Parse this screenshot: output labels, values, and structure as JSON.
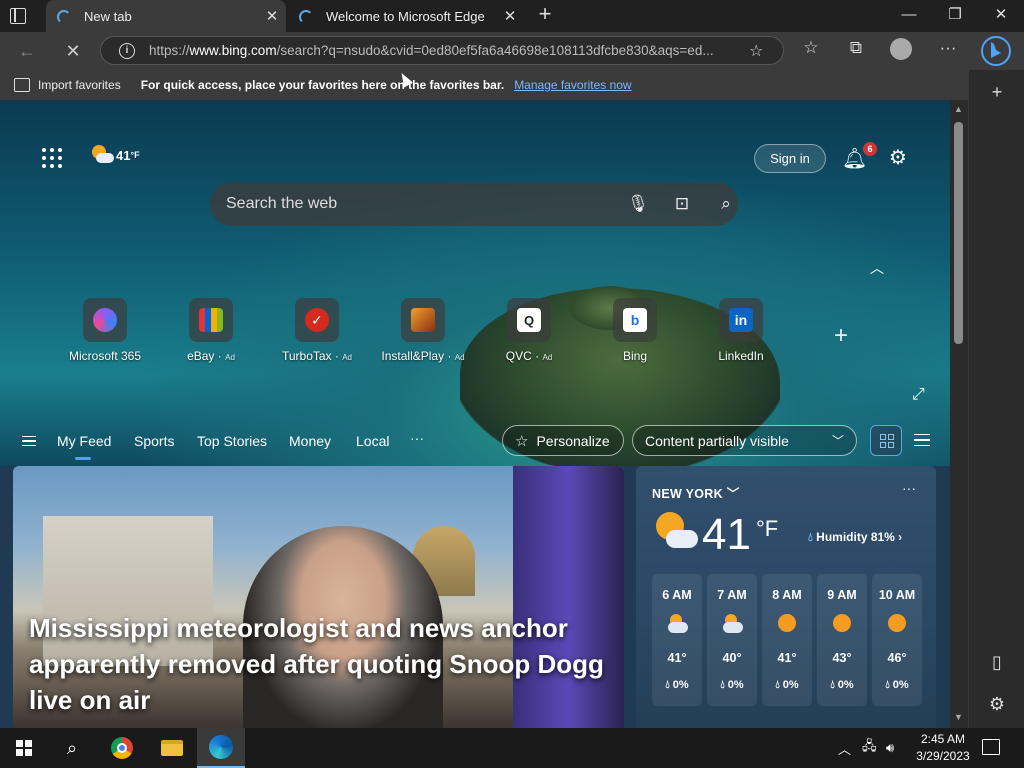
{
  "tabs": [
    {
      "title": "New tab",
      "active": true
    },
    {
      "title": "Welcome to Microsoft Edge",
      "active": false
    }
  ],
  "toolbar": {
    "url_prefix": "https://",
    "url_domain": "www.bing.com",
    "url_rest": "/search?q=nsudo&cvid=0ed80ef5fa6a46698e108113dfcbe830&aqs=ed..."
  },
  "favorites_bar": {
    "import_label": "Import favorites",
    "hint": "For quick access, place your favorites here on the favorites bar.",
    "manage_link": "Manage favorites now"
  },
  "header": {
    "weather_temp": "41",
    "weather_unit": "°F",
    "sign_in": "Sign in",
    "notification_count": "6"
  },
  "search": {
    "placeholder": "Search the web"
  },
  "quick_links": [
    {
      "label": "Microsoft 365",
      "ad": "",
      "icon": "microsoft-365-icon",
      "color": "#6b5cd6"
    },
    {
      "label": "eBay",
      "ad": "Ad",
      "icon": "ebay-icon",
      "color": "#e53238"
    },
    {
      "label": "TurboTax",
      "ad": "Ad",
      "icon": "turbotax-icon",
      "color": "#d52b1e"
    },
    {
      "label": "Install&Play",
      "ad": "Ad",
      "icon": "install-play-icon",
      "color": "#c0641c"
    },
    {
      "label": "QVC",
      "ad": "Ad",
      "icon": "qvc-icon",
      "color": "#ffffff"
    },
    {
      "label": "Bing",
      "ad": "",
      "icon": "bing-icon",
      "color": "#ffffff"
    },
    {
      "label": "LinkedIn",
      "ad": "",
      "icon": "linkedin-icon",
      "color": "#0a66c2"
    }
  ],
  "feed_nav": {
    "items": [
      "My Feed",
      "Sports",
      "Top Stories",
      "Money",
      "Local"
    ],
    "more": "···",
    "personalize": "Personalize",
    "content_visibility": "Content partially visible"
  },
  "news": {
    "headline": "Mississippi meteorologist and news anchor apparently removed after quoting Snoop Dogg live on air"
  },
  "weather_card": {
    "location": "NEW YORK",
    "temp": "41",
    "unit": "°F",
    "humidity": "Humidity 81%",
    "hours": [
      {
        "time": "6 AM",
        "icon": "cloud",
        "temp": "41°",
        "rain": "0%"
      },
      {
        "time": "7 AM",
        "icon": "cloud",
        "temp": "40°",
        "rain": "0%"
      },
      {
        "time": "8 AM",
        "icon": "sun",
        "temp": "41°",
        "rain": "0%"
      },
      {
        "time": "9 AM",
        "icon": "sun",
        "temp": "43°",
        "rain": "0%"
      },
      {
        "time": "10 AM",
        "icon": "sun",
        "temp": "46°",
        "rain": "0%"
      }
    ]
  },
  "taskbar": {
    "time": "2:45 AM",
    "date": "3/29/2023"
  }
}
